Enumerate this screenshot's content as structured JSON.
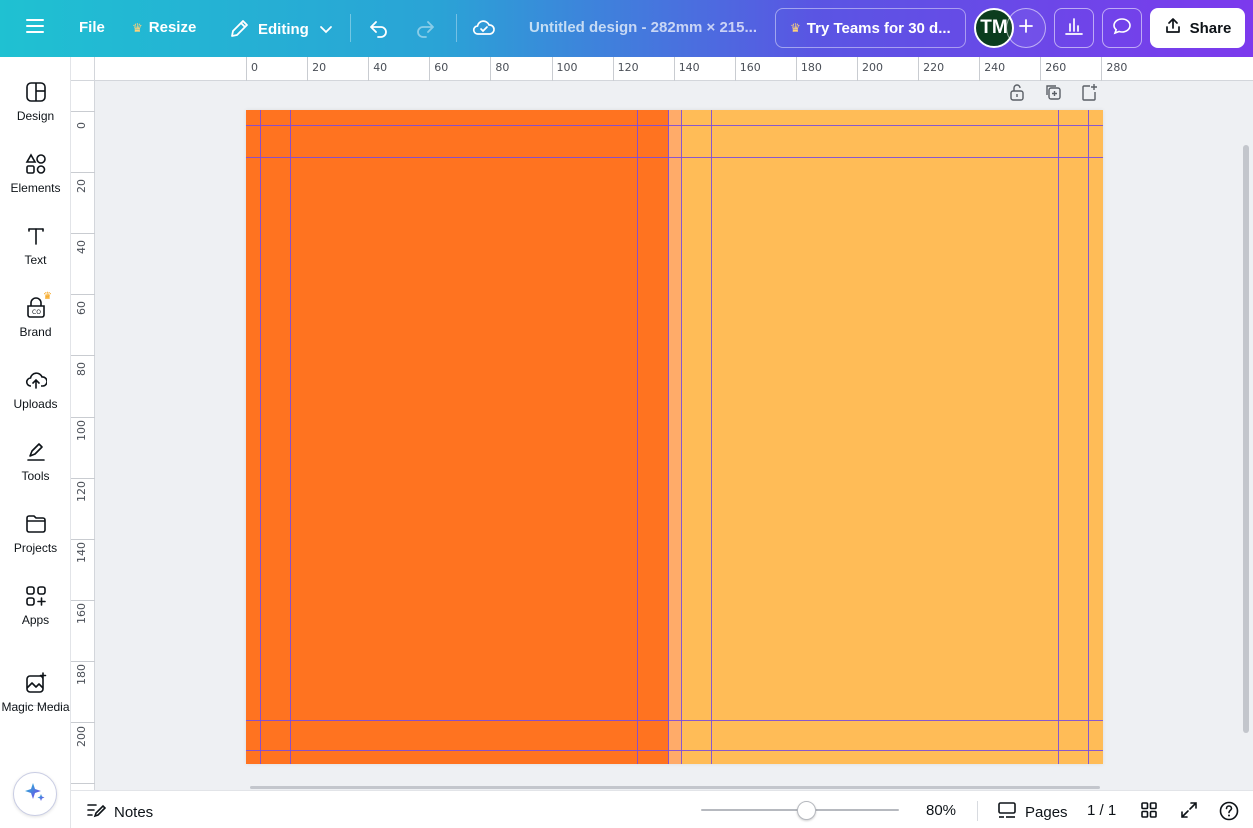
{
  "topbar": {
    "file_label": "File",
    "resize_label": "Resize",
    "editing_label": "Editing",
    "title": "Untitled design - 282mm × 215...",
    "teams_label": "Try Teams for 30 d...",
    "avatar_initials": "TM",
    "share_label": "Share",
    "gradient_colors": [
      "#1fc1d2",
      "#2aa3d6",
      "#5a55e3",
      "#7c3aed"
    ]
  },
  "sidebar": {
    "items": [
      {
        "label": "Design",
        "icon": "design-icon"
      },
      {
        "label": "Elements",
        "icon": "elements-icon"
      },
      {
        "label": "Text",
        "icon": "text-icon"
      },
      {
        "label": "Brand",
        "icon": "brand-icon"
      },
      {
        "label": "Uploads",
        "icon": "upload-cloud-icon"
      },
      {
        "label": "Tools",
        "icon": "pen-tool-icon"
      },
      {
        "label": "Projects",
        "icon": "folder-icon"
      },
      {
        "label": "Apps",
        "icon": "apps-grid-icon"
      },
      {
        "label": "Magic Media",
        "icon": "magic-media-icon"
      }
    ]
  },
  "ruler": {
    "top_labels": [
      "0",
      "20",
      "40",
      "60",
      "80",
      "100",
      "120",
      "140",
      "160",
      "180",
      "200",
      "220",
      "240",
      "260",
      "280"
    ],
    "left_labels": [
      "0",
      "20",
      "40",
      "60",
      "80",
      "100",
      "120",
      "140",
      "160",
      "180",
      "200",
      "0"
    ]
  },
  "canvas": {
    "left_panel_color": "#ff7320",
    "right_panel_color": "#ffbc57",
    "guide_color": "#7b4ddb"
  },
  "bottombar": {
    "notes_label": "Notes",
    "zoom_label": "80%",
    "zoom_level": 0.53,
    "pages_label": "Pages",
    "page_count": "1 / 1"
  }
}
